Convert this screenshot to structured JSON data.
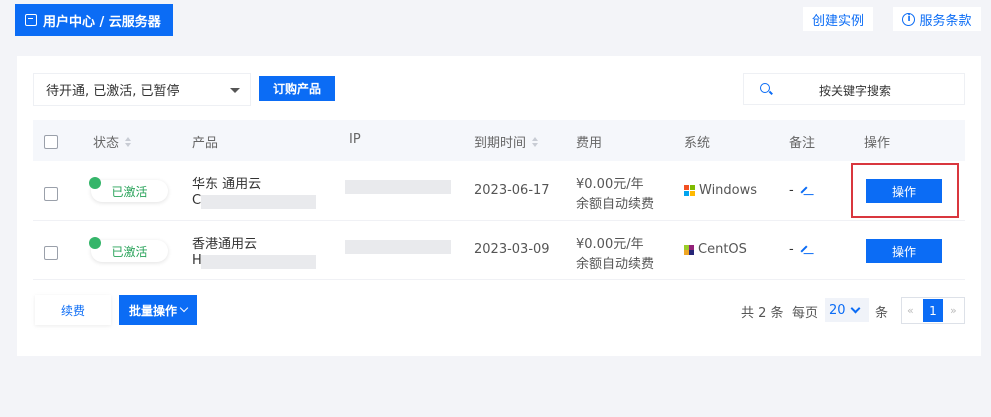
{
  "header": {
    "breadcrumb": "用户中心 / 云服务器",
    "create_instance": "创建实例",
    "terms": "服务条款"
  },
  "toolbar": {
    "filter_value": "待开通, 已激活, 已暂停",
    "order_button": "订购产品",
    "search_placeholder": "按关键字搜索"
  },
  "table": {
    "headers": {
      "status": "状态",
      "product": "产品",
      "ip": "IP",
      "expire": "到期时间",
      "fee": "费用",
      "system": "系统",
      "note": "备注",
      "action": "操作"
    },
    "rows": [
      {
        "status": "已激活",
        "product": "华东 通用云",
        "product_sub": "C",
        "expire": "2023-06-17",
        "fee": "¥0.00元/年",
        "fee_note": "余额自动续费",
        "system": "Windows",
        "note": "-",
        "action": "操作"
      },
      {
        "status": "已激活",
        "product": "香港通用云",
        "product_sub": "H",
        "expire": "2023-03-09",
        "fee": "¥0.00元/年",
        "fee_note": "余额自动续费",
        "system": "CentOS",
        "note": "-",
        "action": "操作"
      }
    ]
  },
  "footer": {
    "renew_button": "续费",
    "batch_button": "批量操作",
    "total_text": "共 2 条",
    "per_page_label": "每页",
    "per_page_value": "20",
    "per_page_unit": "条",
    "prev": "«",
    "current_page": "1",
    "next": "»"
  },
  "colors": {
    "primary": "#0b6cf5",
    "success": "#35b56a",
    "highlight": "#d9363e"
  }
}
